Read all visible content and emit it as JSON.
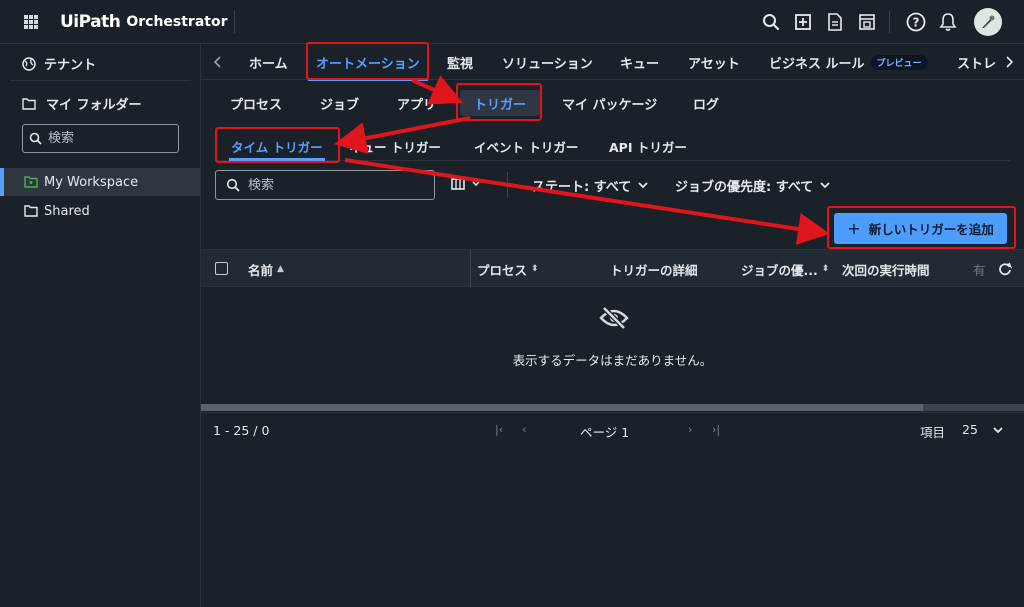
{
  "header": {
    "brand_logo": "UiPath",
    "brand_product": "Orchestrator",
    "icons": [
      "search-icon",
      "add-box-icon",
      "document-icon",
      "window-icon",
      "help-icon",
      "bell-icon"
    ]
  },
  "sidebar": {
    "tenant_label": "テナント",
    "my_folder_label": "マイ フォルダー",
    "search_placeholder": "検索",
    "items": [
      {
        "label": "My Workspace",
        "active": true
      },
      {
        "label": "Shared",
        "active": false
      }
    ]
  },
  "nav": {
    "tabs": [
      {
        "label": "ホーム"
      },
      {
        "label": "オートメーション",
        "active": true
      },
      {
        "label": "監視"
      },
      {
        "label": "ソリューション"
      },
      {
        "label": "キュー"
      },
      {
        "label": "アセット"
      },
      {
        "label": "ビジネス ルール",
        "badge": "プレビュー"
      },
      {
        "label": "ストレ"
      }
    ]
  },
  "subnav": {
    "tabs": [
      {
        "label": "プロセス"
      },
      {
        "label": "ジョブ"
      },
      {
        "label": "アプリ"
      },
      {
        "label": "トリガー",
        "active": true
      },
      {
        "label": "マイ パッケージ"
      },
      {
        "label": "ログ"
      }
    ]
  },
  "trigger_tabs": [
    {
      "label": "タイム トリガー",
      "active": true
    },
    {
      "label": "キュー トリガー"
    },
    {
      "label": "イベント トリガー"
    },
    {
      "label": "API トリガー"
    }
  ],
  "filters": {
    "search_placeholder": "検索",
    "state": "ステート: すべて",
    "priority": "ジョブの優先度: すべて"
  },
  "add_button": {
    "icon": "+",
    "label": "新しいトリガーを追加"
  },
  "table": {
    "columns": [
      {
        "label": "名前",
        "sort": "▲"
      },
      {
        "label": "プロセス",
        "sort": "⬍"
      },
      {
        "label": "トリガーの詳細"
      },
      {
        "label": "ジョブの優...",
        "sort": "⬍"
      },
      {
        "label": "次回の実行時間"
      },
      {
        "label": "有"
      }
    ],
    "empty_message": "表示するデータはまだありません。"
  },
  "pagination": {
    "range": "1 - 25 / 0",
    "page_label": "ページ 1",
    "items_label": "項目",
    "page_size": "25"
  },
  "colors": {
    "accent": "#56a0ff",
    "annotation": "#e0161c",
    "background": "#1b2128"
  }
}
